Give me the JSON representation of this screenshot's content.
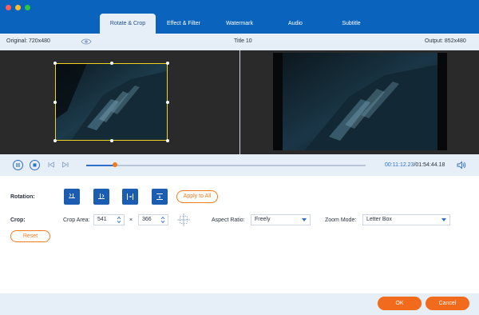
{
  "window": {
    "traffic_colors": [
      "#ff5f57",
      "#febc2e",
      "#28c840"
    ]
  },
  "tabs": [
    {
      "label": "Rotate & Crop",
      "active": true
    },
    {
      "label": "Effect & Filter",
      "active": false
    },
    {
      "label": "Watermark",
      "active": false
    },
    {
      "label": "Audio",
      "active": false
    },
    {
      "label": "Subtitle",
      "active": false
    }
  ],
  "info": {
    "original": "Original: 720x480",
    "title": "Title 10",
    "output": "Output: 852x480",
    "eye_icon": "eye-icon"
  },
  "playback": {
    "current_time": "00:11:12.23",
    "total_time": "/01:54:44.18",
    "progress": 0.1
  },
  "rotation": {
    "label": "Rotation:",
    "buttons": [
      "rotate-left-icon",
      "rotate-right-icon",
      "flip-horizontal-icon",
      "flip-vertical-icon"
    ],
    "apply_label": "Apply to All"
  },
  "crop": {
    "label": "Crop:",
    "area_label": "Crop Area:",
    "width": "541",
    "times": "×",
    "height": "366",
    "aspect_label": "Aspect Ratio:",
    "aspect_value": "Freely",
    "zoom_label": "Zoom Mode:",
    "zoom_value": "Letter Box",
    "reset_label": "Reset"
  },
  "footer": {
    "ok_label": "OK",
    "cancel_label": "Cancel"
  },
  "colors": {
    "brand_blue": "#0a64be",
    "accent_orange": "#f26a1b",
    "crop_border": "#f0d020"
  }
}
